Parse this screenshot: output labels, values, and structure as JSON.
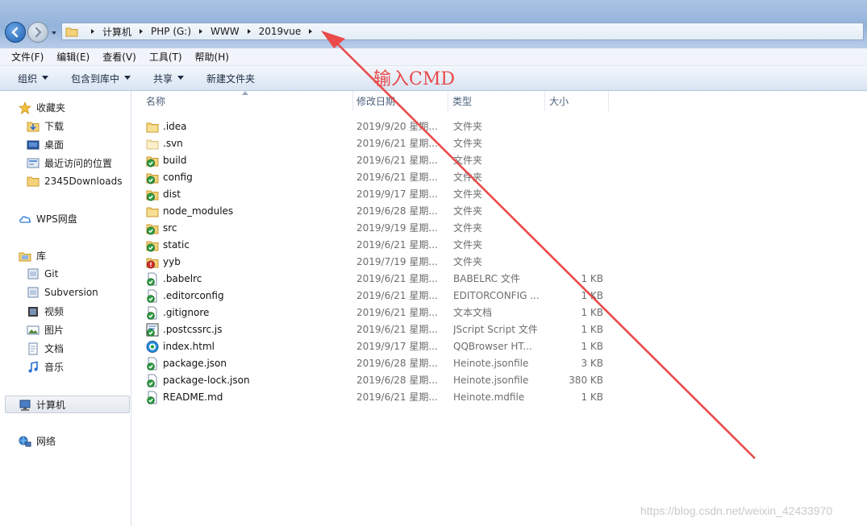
{
  "address_bar": {
    "crumbs": [
      "计算机",
      "PHP (G:)",
      "WWW",
      "2019vue"
    ]
  },
  "menu": [
    "文件(F)",
    "编辑(E)",
    "查看(V)",
    "工具(T)",
    "帮助(H)"
  ],
  "toolbar": {
    "organize": "组织",
    "include_in_library": "包含到库中",
    "share": "共享",
    "new_folder": "新建文件夹"
  },
  "sidebar": {
    "favorites": "收藏夹",
    "downloads": "下载",
    "desktop": "桌面",
    "recent": "最近访问的位置",
    "downloads2345": "2345Downloads",
    "wps": "WPS网盘",
    "libraries": "库",
    "git": "Git",
    "subversion": "Subversion",
    "videos": "视频",
    "pictures": "图片",
    "documents": "文档",
    "music": "音乐",
    "computer": "计算机",
    "network": "网络"
  },
  "columns": {
    "name": "名称",
    "modified": "修改日期",
    "type": "类型",
    "size": "大小"
  },
  "files": [
    {
      "name": ".idea",
      "modified": "2019/9/20 星期...",
      "type": "文件夹",
      "size": "",
      "icon": "folder-icon"
    },
    {
      "name": ".svn",
      "modified": "2019/6/21 星期...",
      "type": "文件夹",
      "size": "",
      "icon": "folder-hidden-icon"
    },
    {
      "name": "build",
      "modified": "2019/6/21 星期...",
      "type": "文件夹",
      "size": "",
      "icon": "svn-folder-ok-icon"
    },
    {
      "name": "config",
      "modified": "2019/6/21 星期...",
      "type": "文件夹",
      "size": "",
      "icon": "svn-folder-ok-icon"
    },
    {
      "name": "dist",
      "modified": "2019/9/17 星期...",
      "type": "文件夹",
      "size": "",
      "icon": "svn-folder-ok-icon"
    },
    {
      "name": "node_modules",
      "modified": "2019/6/28 星期...",
      "type": "文件夹",
      "size": "",
      "icon": "folder-icon"
    },
    {
      "name": "src",
      "modified": "2019/9/19 星期...",
      "type": "文件夹",
      "size": "",
      "icon": "svn-folder-ok-icon"
    },
    {
      "name": "static",
      "modified": "2019/6/21 星期...",
      "type": "文件夹",
      "size": "",
      "icon": "svn-folder-ok-icon"
    },
    {
      "name": "yyb",
      "modified": "2019/7/19 星期...",
      "type": "文件夹",
      "size": "",
      "icon": "svn-folder-modified-icon"
    },
    {
      "name": ".babelrc",
      "modified": "2019/6/21 星期...",
      "type": "BABELRC 文件",
      "size": "1 KB",
      "icon": "svn-file-ok-icon"
    },
    {
      "name": ".editorconfig",
      "modified": "2019/6/21 星期...",
      "type": "EDITORCONFIG ...",
      "size": "1 KB",
      "icon": "svn-file-ok-icon"
    },
    {
      "name": ".gitignore",
      "modified": "2019/6/21 星期...",
      "type": "文本文档",
      "size": "1 KB",
      "icon": "svn-file-ok-icon"
    },
    {
      "name": ".postcssrc.js",
      "modified": "2019/6/21 星期...",
      "type": "JScript Script 文件",
      "size": "1 KB",
      "icon": "svn-script-file-icon"
    },
    {
      "name": "index.html",
      "modified": "2019/9/17 星期...",
      "type": "QQBrowser HT...",
      "size": "1 KB",
      "icon": "browser-file-icon"
    },
    {
      "name": "package.json",
      "modified": "2019/6/28 星期...",
      "type": "Heinote.jsonfile",
      "size": "3 KB",
      "icon": "svn-file-ok-icon"
    },
    {
      "name": "package-lock.json",
      "modified": "2019/6/28 星期...",
      "type": "Heinote.jsonfile",
      "size": "380 KB",
      "icon": "svn-file-ok-icon"
    },
    {
      "name": "README.md",
      "modified": "2019/6/21 星期...",
      "type": "Heinote.mdfile",
      "size": "1 KB",
      "icon": "svn-file-ok-icon"
    }
  ],
  "annotation": {
    "text": "输入CMD",
    "color": "#e84a4a"
  },
  "watermark": "https://blog.csdn.net/weixin_42433970"
}
